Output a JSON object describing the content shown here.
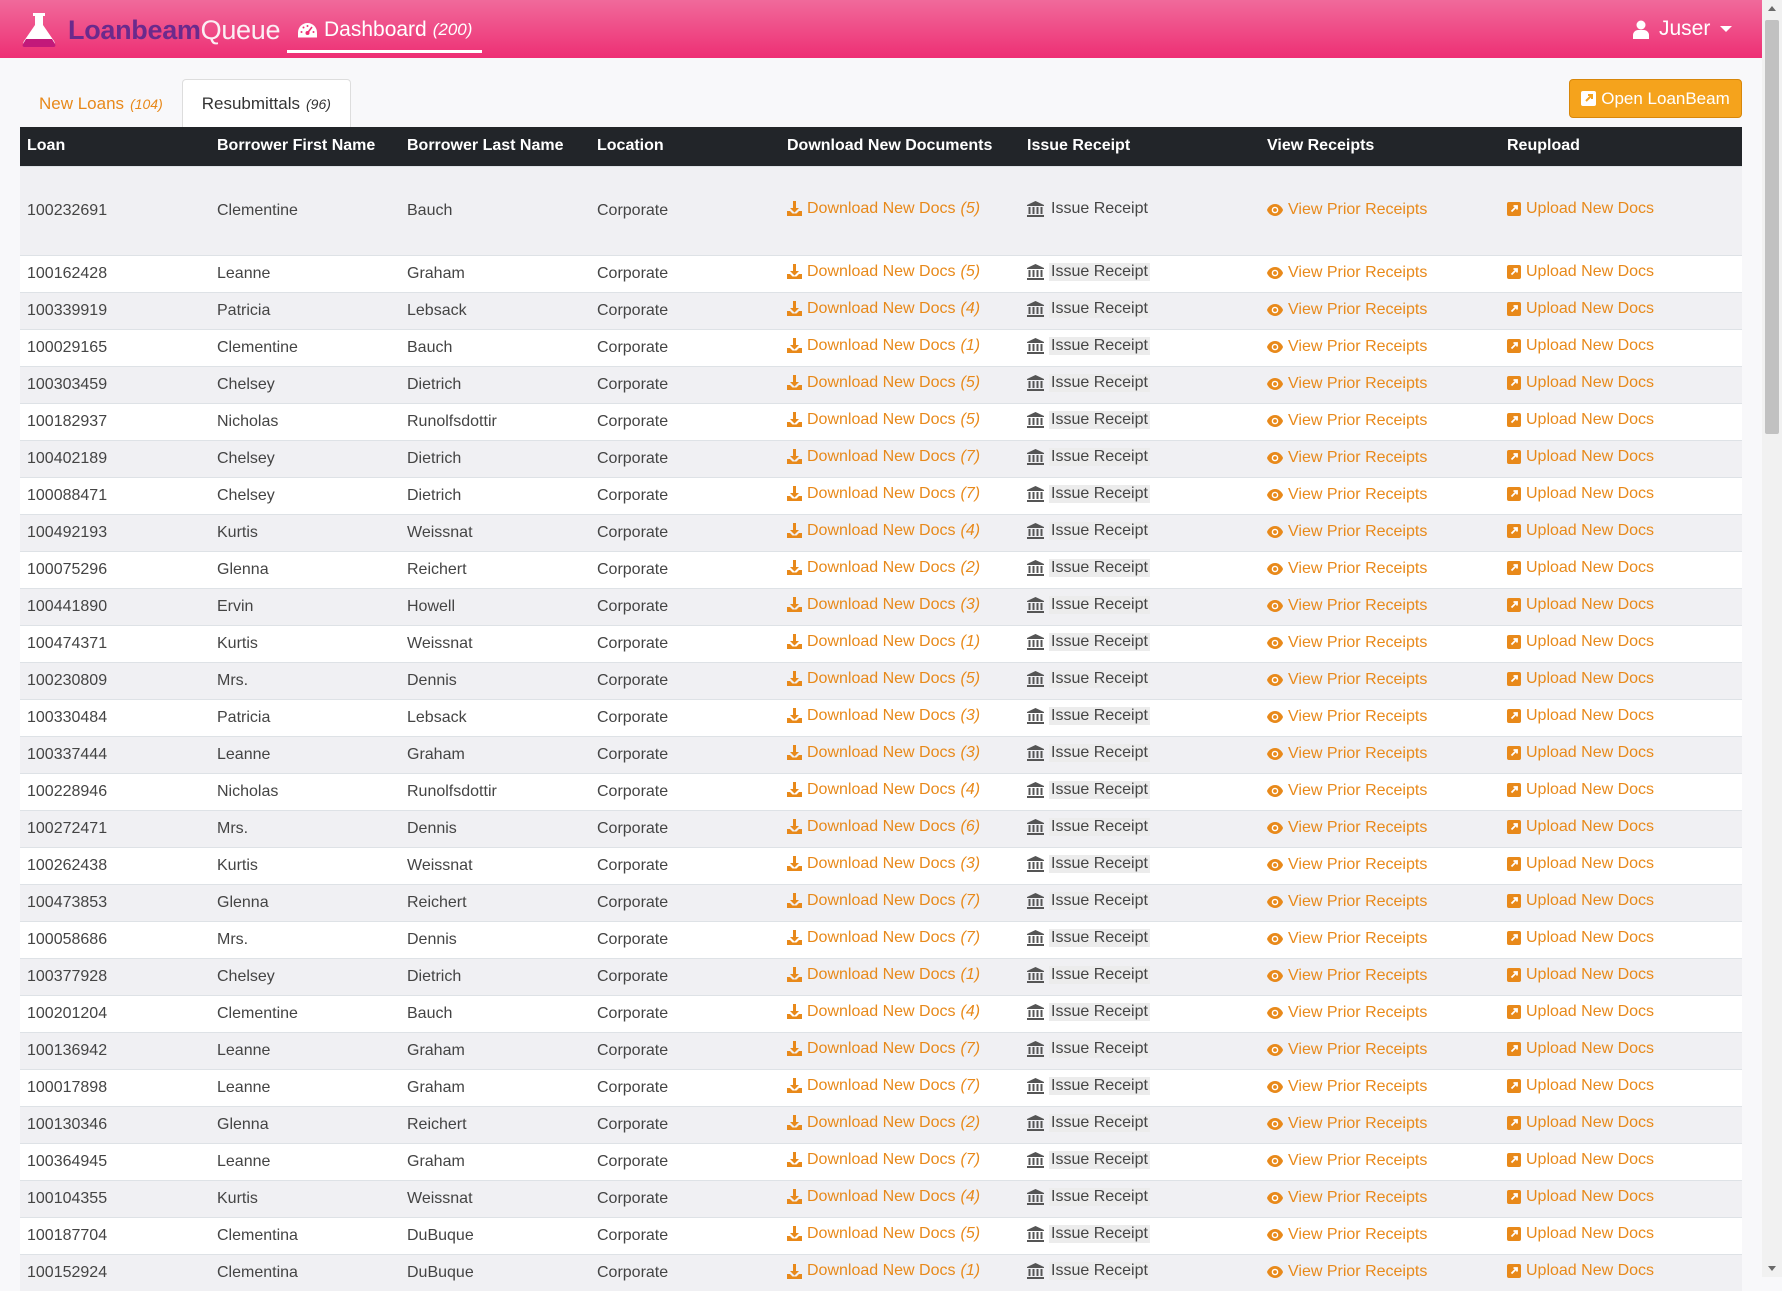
{
  "app": {
    "brand_part1": "Loanbeam",
    "brand_part2": "Queue"
  },
  "nav": {
    "dashboard_label": "Dashboard",
    "dashboard_count": "(200)"
  },
  "user": {
    "name": "Juser"
  },
  "tabs": [
    {
      "label": "New Loans",
      "count": "(104)"
    },
    {
      "label": "Resubmittals",
      "count": "(96)"
    }
  ],
  "open_button": {
    "label": "Open LoanBeam"
  },
  "table": {
    "headers": [
      "Loan",
      "Borrower First Name",
      "Borrower Last Name",
      "Location",
      "Download New Documents",
      "Issue Receipt",
      "View Receipts",
      "Reupload"
    ],
    "download_label": "Download New Docs",
    "issue_label": "Issue Receipt",
    "view_label": "View Prior Receipts",
    "upload_label": "Upload New Docs",
    "rows": [
      {
        "loan": "100232691",
        "first": "Clementine",
        "last": "Bauch",
        "location": "Corporate",
        "docs": "(5)"
      },
      {
        "loan": "100162428",
        "first": "Leanne",
        "last": "Graham",
        "location": "Corporate",
        "docs": "(5)"
      },
      {
        "loan": "100339919",
        "first": "Patricia",
        "last": "Lebsack",
        "location": "Corporate",
        "docs": "(4)"
      },
      {
        "loan": "100029165",
        "first": "Clementine",
        "last": "Bauch",
        "location": "Corporate",
        "docs": "(1)"
      },
      {
        "loan": "100303459",
        "first": "Chelsey",
        "last": "Dietrich",
        "location": "Corporate",
        "docs": "(5)"
      },
      {
        "loan": "100182937",
        "first": "Nicholas",
        "last": "Runolfsdottir",
        "location": "Corporate",
        "docs": "(5)"
      },
      {
        "loan": "100402189",
        "first": "Chelsey",
        "last": "Dietrich",
        "location": "Corporate",
        "docs": "(7)"
      },
      {
        "loan": "100088471",
        "first": "Chelsey",
        "last": "Dietrich",
        "location": "Corporate",
        "docs": "(7)"
      },
      {
        "loan": "100492193",
        "first": "Kurtis",
        "last": "Weissnat",
        "location": "Corporate",
        "docs": "(4)"
      },
      {
        "loan": "100075296",
        "first": "Glenna",
        "last": "Reichert",
        "location": "Corporate",
        "docs": "(2)"
      },
      {
        "loan": "100441890",
        "first": "Ervin",
        "last": "Howell",
        "location": "Corporate",
        "docs": "(3)"
      },
      {
        "loan": "100474371",
        "first": "Kurtis",
        "last": "Weissnat",
        "location": "Corporate",
        "docs": "(1)"
      },
      {
        "loan": "100230809",
        "first": "Mrs.",
        "last": "Dennis",
        "location": "Corporate",
        "docs": "(5)"
      },
      {
        "loan": "100330484",
        "first": "Patricia",
        "last": "Lebsack",
        "location": "Corporate",
        "docs": "(3)"
      },
      {
        "loan": "100337444",
        "first": "Leanne",
        "last": "Graham",
        "location": "Corporate",
        "docs": "(3)"
      },
      {
        "loan": "100228946",
        "first": "Nicholas",
        "last": "Runolfsdottir",
        "location": "Corporate",
        "docs": "(4)"
      },
      {
        "loan": "100272471",
        "first": "Mrs.",
        "last": "Dennis",
        "location": "Corporate",
        "docs": "(6)"
      },
      {
        "loan": "100262438",
        "first": "Kurtis",
        "last": "Weissnat",
        "location": "Corporate",
        "docs": "(3)"
      },
      {
        "loan": "100473853",
        "first": "Glenna",
        "last": "Reichert",
        "location": "Corporate",
        "docs": "(7)"
      },
      {
        "loan": "100058686",
        "first": "Mrs.",
        "last": "Dennis",
        "location": "Corporate",
        "docs": "(7)"
      },
      {
        "loan": "100377928",
        "first": "Chelsey",
        "last": "Dietrich",
        "location": "Corporate",
        "docs": "(1)"
      },
      {
        "loan": "100201204",
        "first": "Clementine",
        "last": "Bauch",
        "location": "Corporate",
        "docs": "(4)"
      },
      {
        "loan": "100136942",
        "first": "Leanne",
        "last": "Graham",
        "location": "Corporate",
        "docs": "(7)"
      },
      {
        "loan": "100017898",
        "first": "Leanne",
        "last": "Graham",
        "location": "Corporate",
        "docs": "(7)"
      },
      {
        "loan": "100130346",
        "first": "Glenna",
        "last": "Reichert",
        "location": "Corporate",
        "docs": "(2)"
      },
      {
        "loan": "100364945",
        "first": "Leanne",
        "last": "Graham",
        "location": "Corporate",
        "docs": "(7)"
      },
      {
        "loan": "100104355",
        "first": "Kurtis",
        "last": "Weissnat",
        "location": "Corporate",
        "docs": "(4)"
      },
      {
        "loan": "100187704",
        "first": "Clementina",
        "last": "DuBuque",
        "location": "Corporate",
        "docs": "(5)"
      },
      {
        "loan": "100152924",
        "first": "Clementina",
        "last": "DuBuque",
        "location": "Corporate",
        "docs": "(1)"
      }
    ]
  },
  "colors": {
    "navbar": "#ee2f74",
    "accent": "#e8891a",
    "header_bg": "#222529",
    "brand_dark": "#6b2a8c",
    "button": "#f5a31c"
  }
}
